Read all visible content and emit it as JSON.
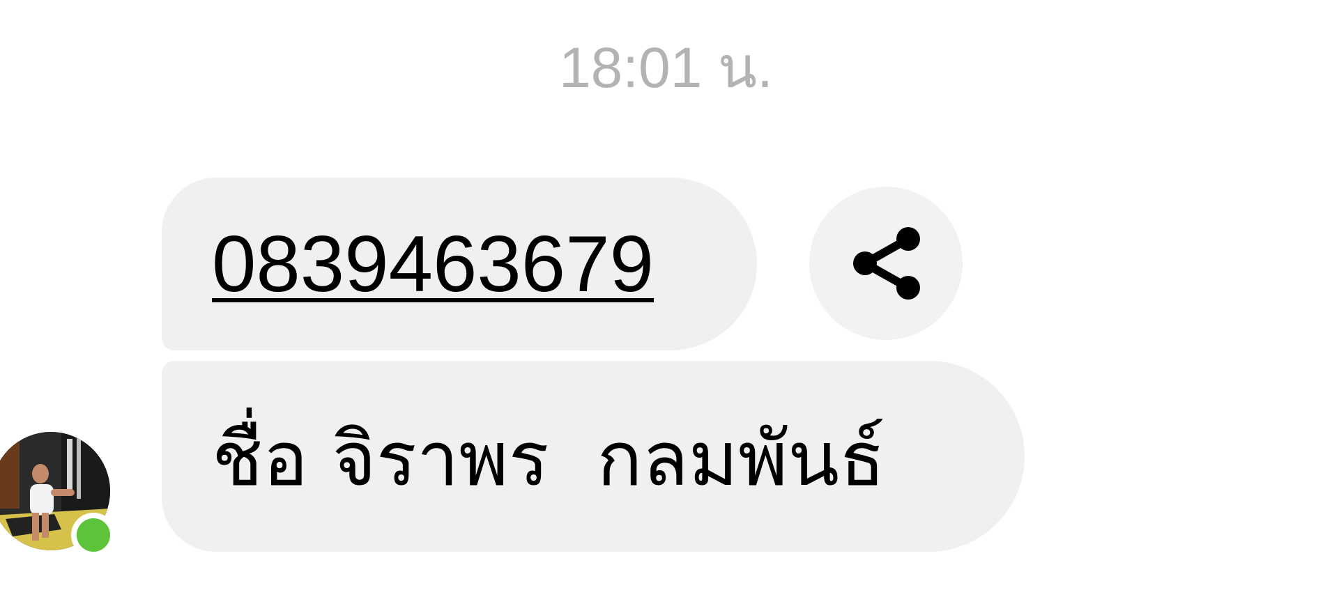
{
  "chat": {
    "timestamp": "18:01 น.",
    "messages": [
      {
        "text": "0839463679",
        "type": "phone-link"
      },
      {
        "text": "ชื่อ จิราพร  กลมพันธ์",
        "type": "text"
      }
    ],
    "share_icon": "share-icon",
    "sender": {
      "avatar": "avatar",
      "online": true,
      "status_color": "#5cc33a"
    }
  },
  "colors": {
    "bubble_bg": "#f0f0f0",
    "timestamp": "#b3b3b3",
    "text": "#000000"
  }
}
